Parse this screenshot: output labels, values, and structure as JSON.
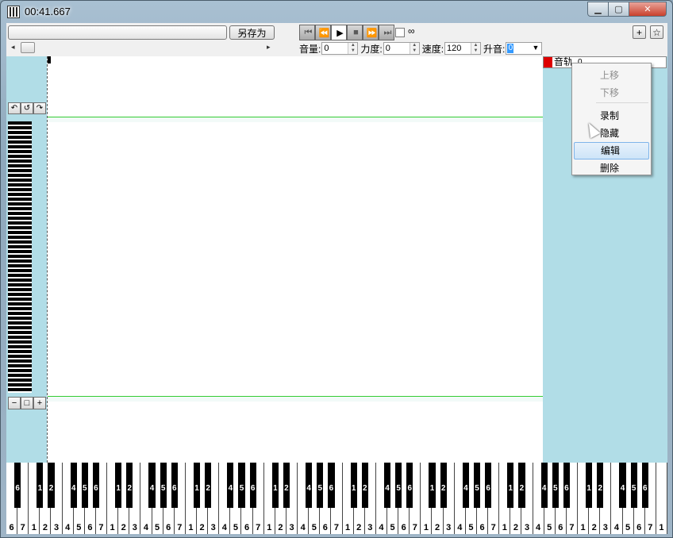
{
  "window": {
    "title": "00:41.667",
    "min_glyph": "▁",
    "max_glyph": "▢",
    "close_glyph": "✕"
  },
  "toolbar": {
    "saveas_label": "另存为",
    "loop_symbol": "∞",
    "volume_label": "音量:",
    "volume_value": "0",
    "force_label": "力度:",
    "force_value": "0",
    "speed_label": "速度:",
    "speed_value": "120",
    "pitch_label": "升音:",
    "pitch_value": "0",
    "plus_label": "+",
    "star_label": "☆"
  },
  "transport": [
    "⏮",
    "⏪",
    "▶",
    "■",
    "⏩",
    "⏭"
  ],
  "left_panel": {
    "undo_buttons": [
      "↶",
      "↺",
      "↷"
    ],
    "zoom_buttons": [
      "−",
      "□",
      "+"
    ]
  },
  "track": {
    "label": "音轨",
    "value": "0",
    "color": "#dd0000"
  },
  "context_menu": [
    {
      "label": "上移",
      "disabled": true
    },
    {
      "label": "下移",
      "disabled": true
    },
    {
      "label": "录制",
      "disabled": false
    },
    {
      "label": "隐藏",
      "disabled": false
    },
    {
      "label": "编辑",
      "disabled": false,
      "hover": true
    },
    {
      "label": "删除",
      "disabled": false
    }
  ],
  "keyboard": {
    "white_labels": [
      "6",
      "7",
      "1",
      "2",
      "3",
      "4",
      "5",
      "6",
      "7",
      "1",
      "2",
      "3",
      "4",
      "5",
      "6",
      "7",
      "1",
      "2",
      "3",
      "4",
      "5",
      "6",
      "7",
      "1",
      "2",
      "3",
      "4",
      "5",
      "6",
      "7",
      "1",
      "2",
      "3",
      "4",
      "5",
      "6",
      "7",
      "1",
      "2",
      "3",
      "4",
      "5",
      "6",
      "7",
      "1",
      "2",
      "3",
      "4",
      "5",
      "6",
      "7",
      "1",
      "2",
      "3",
      "4",
      "5",
      "6",
      "7",
      "1"
    ],
    "black_labels": [
      "6",
      "1",
      "2",
      "4",
      "5",
      "6",
      "1",
      "2",
      "4",
      "5",
      "6",
      "1",
      "2",
      "4",
      "5",
      "6",
      "1",
      "2",
      "4",
      "5",
      "6",
      "1",
      "2",
      "4",
      "5",
      "6",
      "1",
      "2",
      "4",
      "5",
      "6",
      "1",
      "2",
      "4",
      "5",
      "6",
      "1",
      "2",
      "4",
      "5",
      "6"
    ]
  },
  "colors": {
    "panel_bg": "#b1dde7",
    "guide_line": "#33cc33",
    "track_color": "#dd0000"
  }
}
